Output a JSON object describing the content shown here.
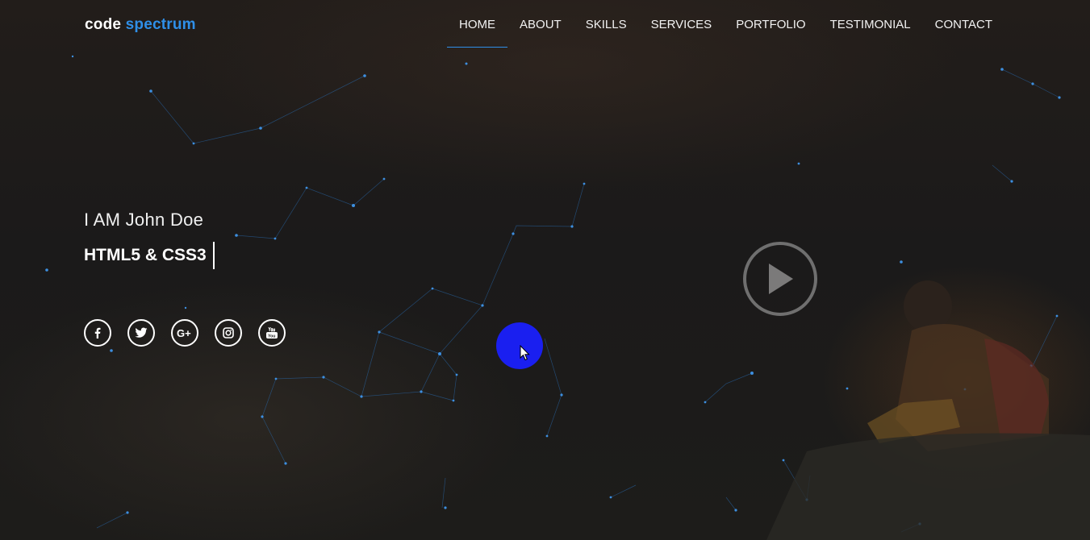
{
  "brand": {
    "part1": "code",
    "part2": "spectrum"
  },
  "nav": {
    "items": [
      {
        "label": "HOME",
        "active": true
      },
      {
        "label": "ABOUT"
      },
      {
        "label": "SKILLS"
      },
      {
        "label": "SERVICES"
      },
      {
        "label": "PORTFOLIO"
      },
      {
        "label": "TESTIMONIAL"
      },
      {
        "label": "CONTACT"
      }
    ]
  },
  "hero": {
    "greeting": "I AM John Doe",
    "typed_text": "HTML5 & CSS3"
  },
  "socials": [
    {
      "icon": "facebook-icon"
    },
    {
      "icon": "twitter-icon"
    },
    {
      "icon": "google-plus-icon"
    },
    {
      "icon": "instagram-icon"
    },
    {
      "icon": "youtube-icon"
    }
  ],
  "video": {
    "icon": "play-icon"
  },
  "colors": {
    "accent": "#2f8fe8",
    "cursor_highlight": "#1a1ff0",
    "background": "#1b1b1a"
  }
}
